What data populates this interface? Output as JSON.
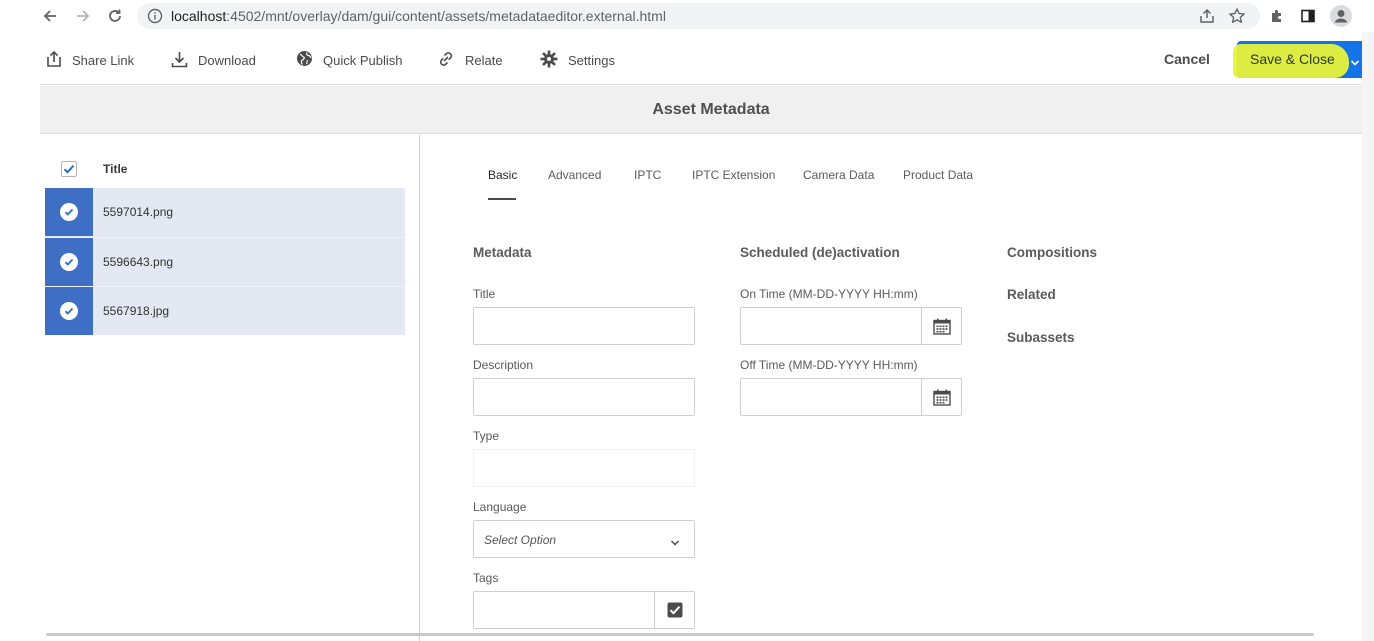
{
  "browser": {
    "url_host": "localhost",
    "url_rest": ":4502/mnt/overlay/dam/gui/content/assets/metadataeditor.external.html",
    "icons": [
      "back-arrow-icon",
      "forward-arrow-icon",
      "reload-icon",
      "info-icon",
      "share-icon",
      "star-icon",
      "extensions-icon",
      "sidepanel-icon",
      "profile-icon"
    ]
  },
  "toolbar": {
    "share_link": "Share Link",
    "download": "Download",
    "quick_publish": "Quick Publish",
    "relate": "Relate",
    "settings": "Settings",
    "cancel": "Cancel",
    "save_close": "Save & Close"
  },
  "page_title": "Asset Metadata",
  "asset_list": {
    "header_title": "Title",
    "items": [
      {
        "name": "5597014.png",
        "selected": true
      },
      {
        "name": "5596643.png",
        "selected": true
      },
      {
        "name": "5567918.jpg",
        "selected": true
      }
    ]
  },
  "tabs": [
    "Basic",
    "Advanced",
    "IPTC",
    "IPTC Extension",
    "Camera Data",
    "Product Data"
  ],
  "active_tab": "Basic",
  "metadata": {
    "heading": "Metadata",
    "title_label": "Title",
    "description_label": "Description",
    "type_label": "Type",
    "language_label": "Language",
    "language_value": "Select Option",
    "tags_label": "Tags"
  },
  "scheduled": {
    "heading": "Scheduled (de)activation",
    "on_time_label": "On Time (MM-DD-YYYY HH:mm)",
    "off_time_label": "Off Time (MM-DD-YYYY HH:mm)"
  },
  "side_links": [
    "Compositions",
    "Related",
    "Subassets"
  ],
  "colors": {
    "accent": "#1473e6",
    "highlight": "#e8f23a",
    "row_selected": "#e3e8f2",
    "thumb_blue": "#3f6fc4"
  }
}
